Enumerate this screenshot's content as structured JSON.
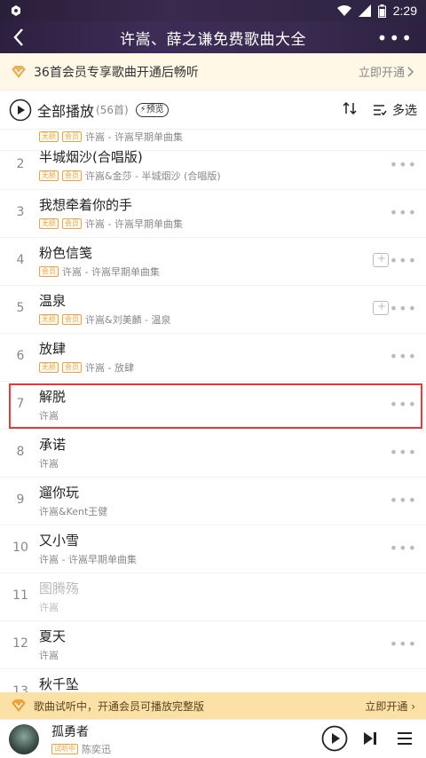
{
  "status_bar": {
    "time": "2:29"
  },
  "navbar": {
    "title": "许嵩、薛之谦免费歌曲大全"
  },
  "vip_banner": {
    "text": "36首会员专享歌曲开通后畅听",
    "cta": "立即开通"
  },
  "toolbar": {
    "play_all": "全部播放",
    "count": "(56首)",
    "preview_badge": "预览",
    "multi_select": "多选"
  },
  "songs": [
    {
      "num": "",
      "name": "",
      "tags": [
        "无损",
        "会员"
      ],
      "sub": "许嵩 - 许嵩早期单曲集"
    },
    {
      "num": "2",
      "name": "半城烟沙(合唱版)",
      "tags": [
        "无损",
        "会员"
      ],
      "sub": "许嵩&金莎 - 半城烟沙 (合唱版)"
    },
    {
      "num": "3",
      "name": "我想牵着你的手",
      "tags": [
        "无损",
        "会员"
      ],
      "sub": "许嵩 - 许嵩早期单曲集"
    },
    {
      "num": "4",
      "name": "粉色信笺",
      "tags": [
        "会员"
      ],
      "sub": "许嵩 - 许嵩早期单曲集"
    },
    {
      "num": "5",
      "name": "温泉",
      "tags": [
        "无损",
        "会员"
      ],
      "sub": "许嵩&刘美麟 - 温泉"
    },
    {
      "num": "6",
      "name": "放肆",
      "tags": [
        "无损",
        "会员"
      ],
      "sub": "许嵩 - 放肆"
    },
    {
      "num": "7",
      "name": "解脱",
      "tags": [],
      "sub": "许嵩"
    },
    {
      "num": "8",
      "name": "承诺",
      "tags": [],
      "sub": "许嵩"
    },
    {
      "num": "9",
      "name": "遛你玩",
      "tags": [],
      "sub": "许嵩&Kent王健"
    },
    {
      "num": "10",
      "name": "又小雪",
      "tags": [],
      "sub": "许嵩 - 许嵩早期单曲集"
    },
    {
      "num": "11",
      "name": "图腾殇",
      "tags": [],
      "sub": "许嵩"
    },
    {
      "num": "12",
      "name": "夏天",
      "tags": [],
      "sub": "许嵩"
    },
    {
      "num": "13",
      "name": "秋千坠",
      "tags": [],
      "sub": ""
    }
  ],
  "trial_bar": {
    "text": "歌曲试听中，开通会员可播放完整版",
    "cta": "立即开通"
  },
  "player": {
    "song": "孤勇者",
    "badge": "试听中",
    "artist": "陈奕迅"
  },
  "colors": {
    "accent_vip": "#f3a13b",
    "highlight": "#e63a3a",
    "header": "#3a2a50"
  }
}
